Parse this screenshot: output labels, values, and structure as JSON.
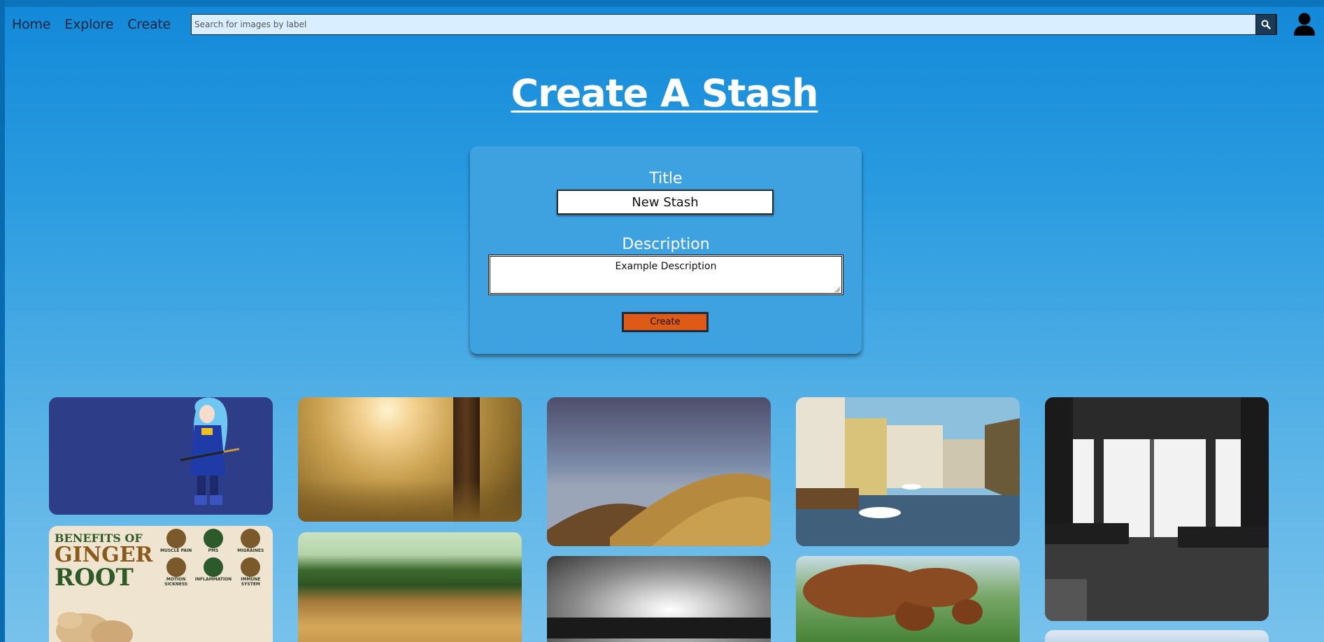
{
  "nav": {
    "home": "Home",
    "explore": "Explore",
    "create": "Create"
  },
  "search": {
    "placeholder": "Search for images by label",
    "button_icon": "search-icon"
  },
  "account": {
    "icon": "user-icon"
  },
  "page": {
    "title": "Create A Stash"
  },
  "form": {
    "title_label": "Title",
    "title_value": "New Stash",
    "description_label": "Description",
    "description_value": "Example Description",
    "create_label": "Create"
  },
  "gallery": {
    "ginger_poster": {
      "heading_line1": "BENEFITS OF",
      "heading_line2": "GINGER",
      "heading_line3": "ROOT",
      "items": [
        "MUSCLE PAIN",
        "PMS",
        "MIGRAINES",
        "MOTION SICKNESS",
        "INFLAMMATION",
        "IMMUNE SYSTEM"
      ]
    }
  },
  "colors": {
    "background_top": "#1289d8",
    "background_bottom": "#78c2ec",
    "card": "#3fa2e0",
    "create_button": "#e05a17",
    "search_field": "#d9efff"
  }
}
